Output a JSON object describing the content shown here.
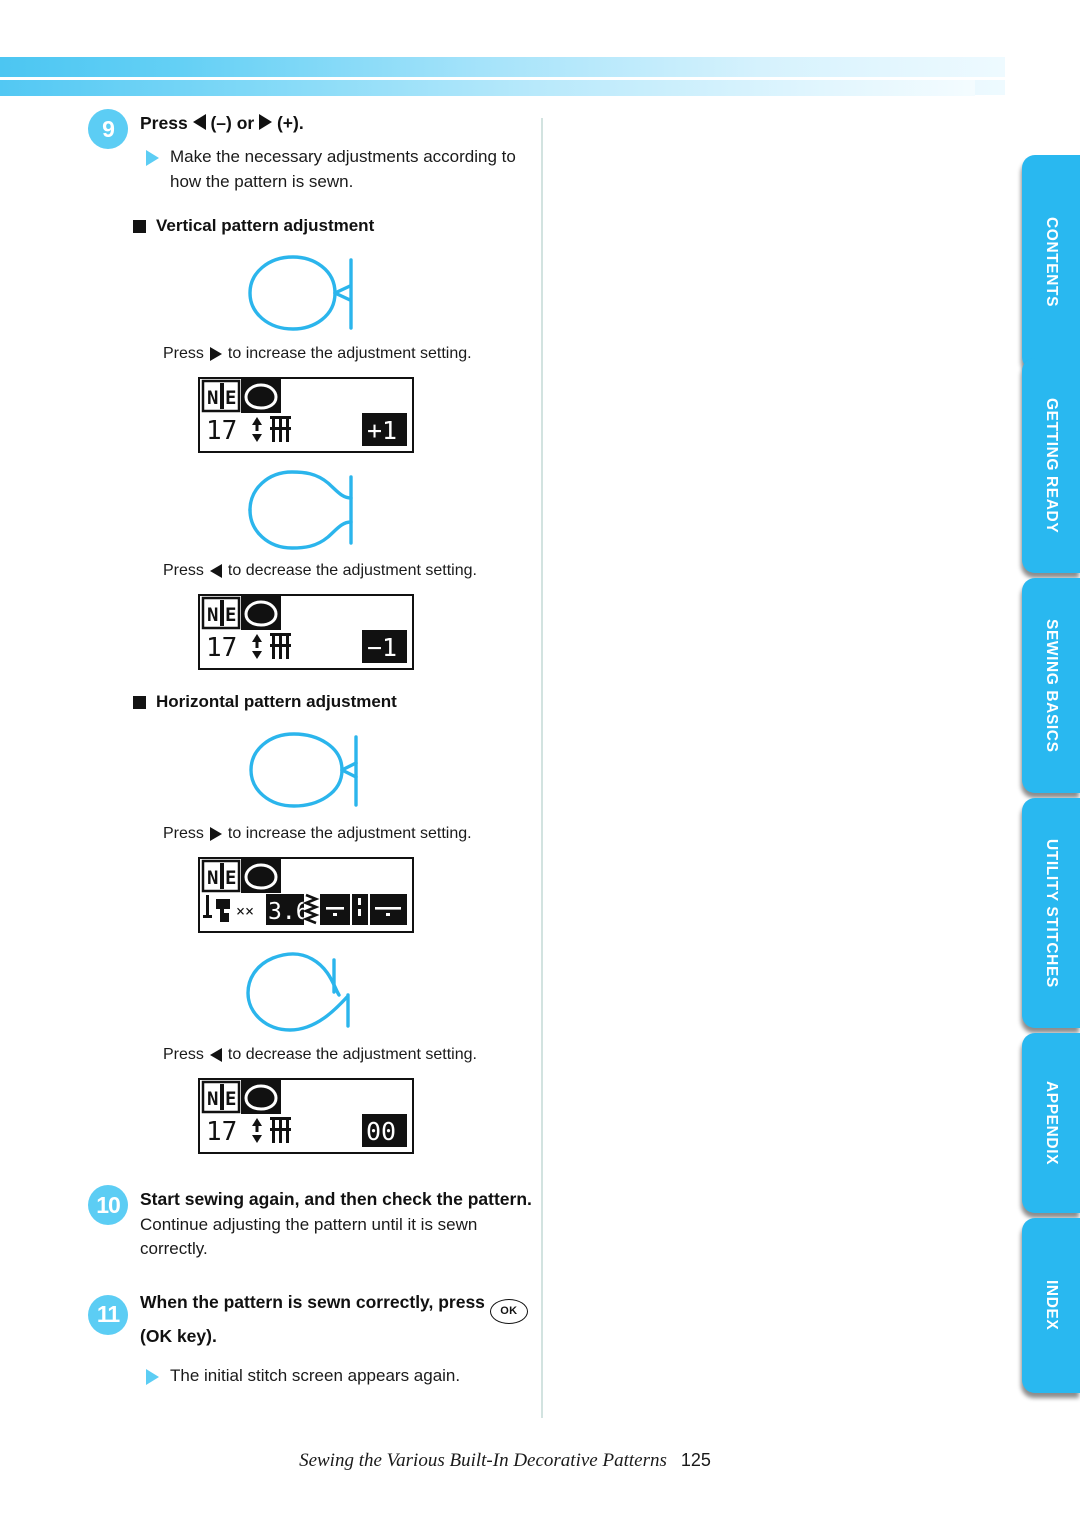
{
  "page": {
    "footer_title": "Sewing the Various Built-In Decorative Patterns",
    "page_number": "125"
  },
  "steps": [
    {
      "number": "9",
      "title_prefix": "Press",
      "title_minus": "(–) or",
      "title_plus": "(+).",
      "bullet": "Make the necessary adjustments according to how the pattern is sewn."
    },
    {
      "number": "10",
      "title": "Start sewing again, and then check the pattern.",
      "body": "Continue adjusting the pattern until it is sewn correctly."
    },
    {
      "number": "11",
      "title_a": "When the pattern is sewn correctly, press",
      "ok_label": "OK",
      "title_b": "(OK key).",
      "bullet": "The initial stitch screen appears again."
    }
  ],
  "sections": [
    {
      "heading": "Vertical pattern adjustment",
      "items": [
        {
          "caption_prefix": "Press",
          "caption_suffix": "to increase the adjustment setting.",
          "arrow": "right",
          "lcd": {
            "pattern_number": "17",
            "value": "+1",
            "mode_icon": "vertical-adjust-icon"
          }
        },
        {
          "caption_prefix": "Press",
          "caption_suffix": "to decrease the adjustment setting.",
          "arrow": "left",
          "lcd": {
            "pattern_number": "17",
            "value": "−1",
            "mode_icon": "vertical-adjust-icon"
          }
        }
      ]
    },
    {
      "heading": "Horizontal pattern adjustment",
      "items": [
        {
          "caption_prefix": "Press",
          "caption_suffix": "to increase the adjustment setting.",
          "arrow": "right",
          "lcd": {
            "width_value": "3.6",
            "mode_icon": "horizontal-adjust-icon"
          }
        },
        {
          "caption_prefix": "Press",
          "caption_suffix": "to decrease the adjustment setting.",
          "arrow": "left",
          "lcd": {
            "pattern_number": "17",
            "value": "00",
            "mode_icon": "vertical-adjust-icon"
          }
        }
      ]
    }
  ],
  "side_tabs": [
    {
      "label": "CONTENTS"
    },
    {
      "label": "GETTING READY"
    },
    {
      "label": "SEWING BASICS"
    },
    {
      "label": "UTILITY STITCHES"
    },
    {
      "label": "APPENDIX"
    },
    {
      "label": "INDEX"
    }
  ],
  "colors": {
    "accent": "#5ccdf4",
    "tab": "#29b8f0",
    "pattern_line": "#2bb5ec"
  }
}
